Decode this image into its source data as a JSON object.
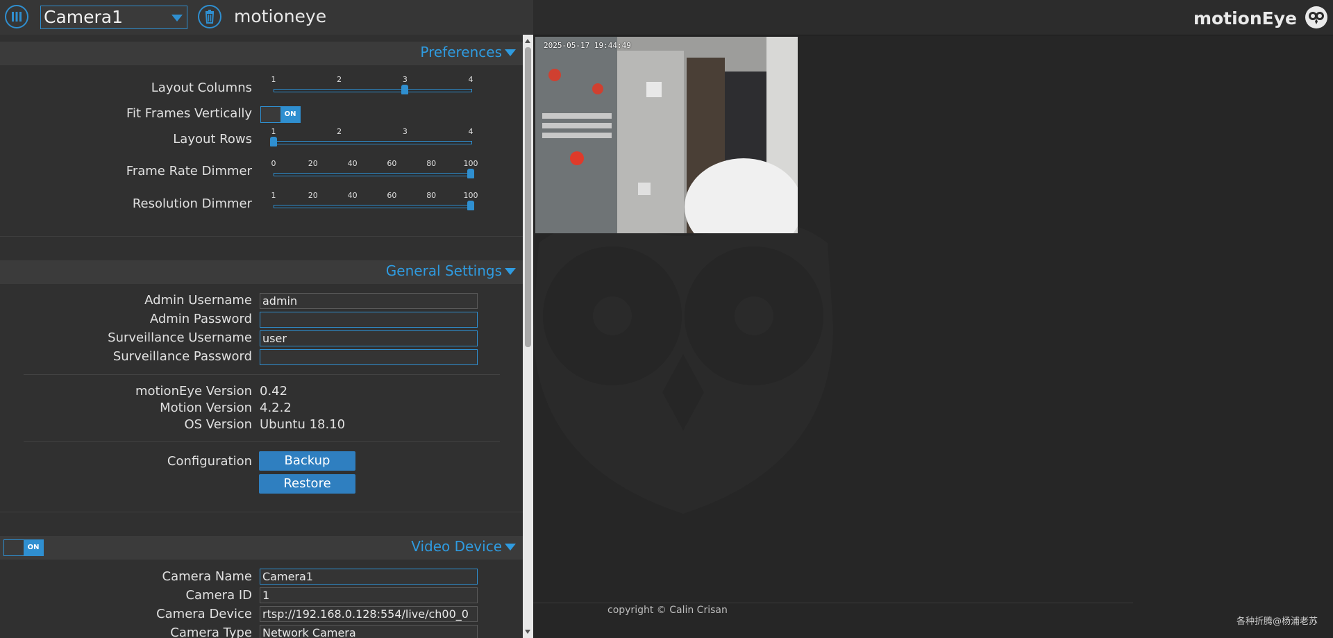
{
  "header": {
    "camera_selected": "Camera1",
    "app_title": "motioneye",
    "brand": "motionEye"
  },
  "colors": {
    "accent": "#2f8fd0",
    "panel": "#303030",
    "section_bar": "#3b3b3b",
    "background": "#262626"
  },
  "icons": {
    "menu": "columns-icon",
    "delete": "trash-icon",
    "logo": "owl-logo-icon"
  },
  "preferences": {
    "title": "Preferences",
    "layout_columns": {
      "label": "Layout Columns",
      "ticks": [
        "1",
        "2",
        "3",
        "4"
      ],
      "value": 3,
      "min": 1,
      "max": 4
    },
    "fit_frames": {
      "label": "Fit Frames Vertically",
      "state": "ON"
    },
    "layout_rows": {
      "label": "Layout Rows",
      "ticks": [
        "1",
        "2",
        "3",
        "4"
      ],
      "value": 1,
      "min": 1,
      "max": 4
    },
    "frame_rate_dimmer": {
      "label": "Frame Rate Dimmer",
      "ticks": [
        "0",
        "20",
        "40",
        "60",
        "80",
        "100"
      ],
      "value": 100,
      "min": 0,
      "max": 100
    },
    "resolution_dimmer": {
      "label": "Resolution Dimmer",
      "ticks": [
        "1",
        "20",
        "40",
        "60",
        "80",
        "100"
      ],
      "value": 100,
      "min": 1,
      "max": 100
    }
  },
  "general": {
    "title": "General Settings",
    "admin_username_label": "Admin Username",
    "admin_username": "admin",
    "admin_password_label": "Admin Password",
    "admin_password": "",
    "surv_username_label": "Surveillance Username",
    "surv_username": "user",
    "surv_password_label": "Surveillance Password",
    "surv_password": "",
    "motioneye_version_label": "motionEye Version",
    "motioneye_version": "0.42",
    "motion_version_label": "Motion Version",
    "motion_version": "4.2.2",
    "os_version_label": "OS Version",
    "os_version": "Ubuntu 18.10",
    "configuration_label": "Configuration",
    "backup": "Backup",
    "restore": "Restore"
  },
  "video_device": {
    "title": "Video Device",
    "state": "ON",
    "camera_name_label": "Camera Name",
    "camera_name": "Camera1",
    "camera_id_label": "Camera ID",
    "camera_id": "1",
    "camera_device_label": "Camera Device",
    "camera_device": "rtsp://192.168.0.128:554/live/ch00_0",
    "camera_type_label": "Camera Type",
    "camera_type": "Network Camera"
  },
  "video": {
    "timestamp": "2025-05-17  19:44:49"
  },
  "footer": {
    "copyright": "copyright © Calin Crisan",
    "watermark": "各种折腾@杨浦老苏"
  }
}
